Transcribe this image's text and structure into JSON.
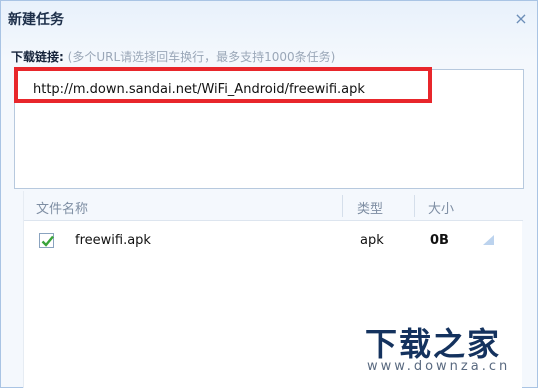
{
  "dialog": {
    "title": "新建任务",
    "close_glyph": "×"
  },
  "link": {
    "label": "下载链接:",
    "hint": "(多个URL请选择回车换行，最多支持1000条任务)",
    "url": "http://m.down.sandai.net/WiFi_Android/freewifi.apk"
  },
  "list": {
    "headers": {
      "name": "文件名称",
      "type": "类型",
      "size": "大小"
    },
    "rows": [
      {
        "checked": true,
        "name": "freewifi.apk",
        "type": "apk",
        "size": "0B"
      }
    ]
  },
  "watermark": {
    "brand": "下载之家",
    "site": "www.downza.cn"
  },
  "colors": {
    "highlight": "#e8262b",
    "brand": "#14325e",
    "check": "#3aa33a",
    "dialog_border": "#a9c4e4"
  }
}
